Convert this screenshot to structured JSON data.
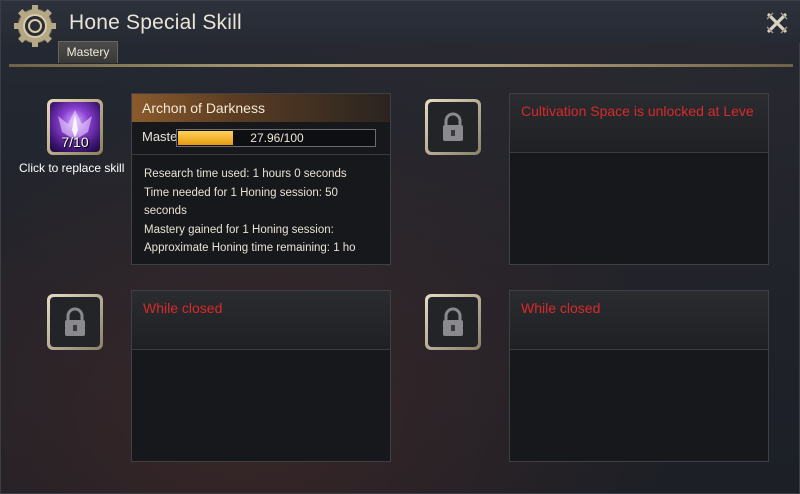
{
  "window": {
    "title": "Hone Special Skill",
    "icons": {
      "title_icon": "gear-icon",
      "close": "close-icon"
    }
  },
  "tabs": [
    {
      "label": "Mastery",
      "active": true
    }
  ],
  "slots": {
    "slot1": {
      "skill_name": "Archon of Darkness",
      "level_badge": "7/10",
      "caption": "Click to replace skill",
      "mastery": {
        "label": "Maste",
        "value_text": "27.96/100",
        "progress_fraction": 0.2796
      },
      "info_lines": [
        "Research time used: 1 hours 0 seconds",
        " Time needed for 1 Honing session: 50",
        "seconds",
        " Mastery gained for 1 Honing session:",
        "Approximate Honing time remaining: 1 ho"
      ]
    },
    "slot2": {
      "status": "Cultivation Space is unlocked at Leve",
      "icon": "lock-icon"
    },
    "slot3": {
      "status": "While closed",
      "icon": "lock-icon"
    },
    "slot4": {
      "status": "While closed",
      "icon": "lock-icon"
    }
  },
  "colors": {
    "locked_text": "#d82a2a",
    "progress_fill": "#f0a818",
    "frame_gold": "#b4a57e"
  }
}
